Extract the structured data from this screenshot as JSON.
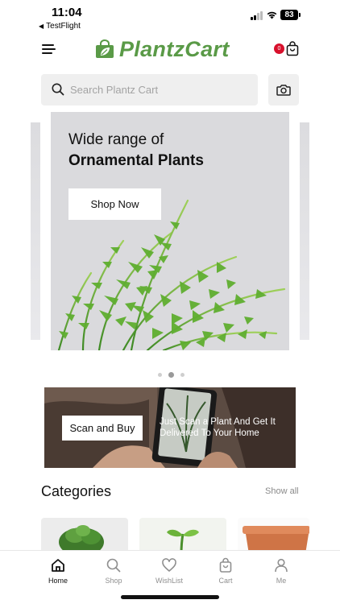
{
  "status_bar": {
    "time": "11:04",
    "back_app": "TestFlight",
    "battery": "83"
  },
  "header": {
    "logo": "PlantzCart",
    "cart_count": "0"
  },
  "search": {
    "placeholder": "Search Plantz Cart"
  },
  "hero": {
    "line1": "Wide range of",
    "line2": "Ornamental Plants",
    "button": "Shop Now",
    "active_slide": 2,
    "slide_count": 3
  },
  "scan_banner": {
    "button": "Scan and Buy",
    "text": "Just Scan a Plant And Get It Delivered To Your Home"
  },
  "categories": {
    "title": "Categories",
    "show_all": "Show all"
  },
  "nav": {
    "items": [
      {
        "label": "Home",
        "icon": "home-icon",
        "active": true
      },
      {
        "label": "Shop",
        "icon": "search-icon"
      },
      {
        "label": "WishList",
        "icon": "heart-icon"
      },
      {
        "label": "Cart",
        "icon": "bag-icon"
      },
      {
        "label": "Me",
        "icon": "person-icon"
      }
    ]
  },
  "colors": {
    "brand": "#5a9a47",
    "badge": "#d8102c"
  }
}
